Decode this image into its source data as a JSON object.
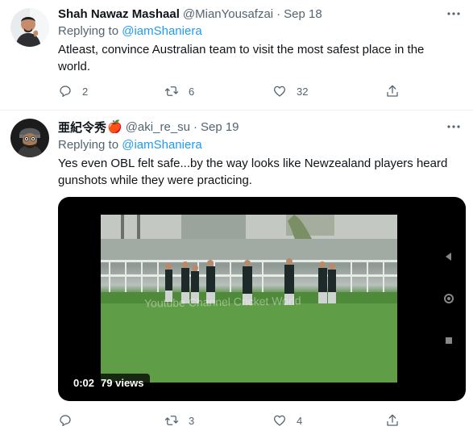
{
  "tweets": [
    {
      "name": "Shah Nawaz Mashaal",
      "handle": "@MianYousafzai",
      "separator": "·",
      "date": "Sep 18",
      "replying_prefix": "Replying to",
      "replying_to": "@iamShaniera",
      "text": "Atleast, convince Australian team to visit the most safest place in the world.",
      "actions": {
        "reply_count": "2",
        "retweet_count": "6",
        "like_count": "32"
      }
    },
    {
      "name": "亜紀令秀",
      "name_emoji": "🍎",
      "handle": "@aki_re_su",
      "separator": "·",
      "date": "Sep 19",
      "replying_prefix": "Replying to",
      "replying_to": "@iamShaniera",
      "text": "Yes even OBL felt safe...by the way looks like Newzealand players heard gunshots while they were practicing.",
      "media": {
        "timestamp": "0:02",
        "views": "79 views",
        "watermark": "Youtube Channel Cricket World"
      },
      "actions": {
        "reply_count": "",
        "retweet_count": "3",
        "like_count": "4"
      }
    }
  ],
  "icons": {
    "more": "more-icon",
    "reply": "reply-icon",
    "retweet": "retweet-icon",
    "like": "like-icon",
    "share": "share-icon"
  },
  "colors": {
    "link": "#1d9bf0",
    "secondary": "#536471",
    "primary": "#0f1419"
  }
}
